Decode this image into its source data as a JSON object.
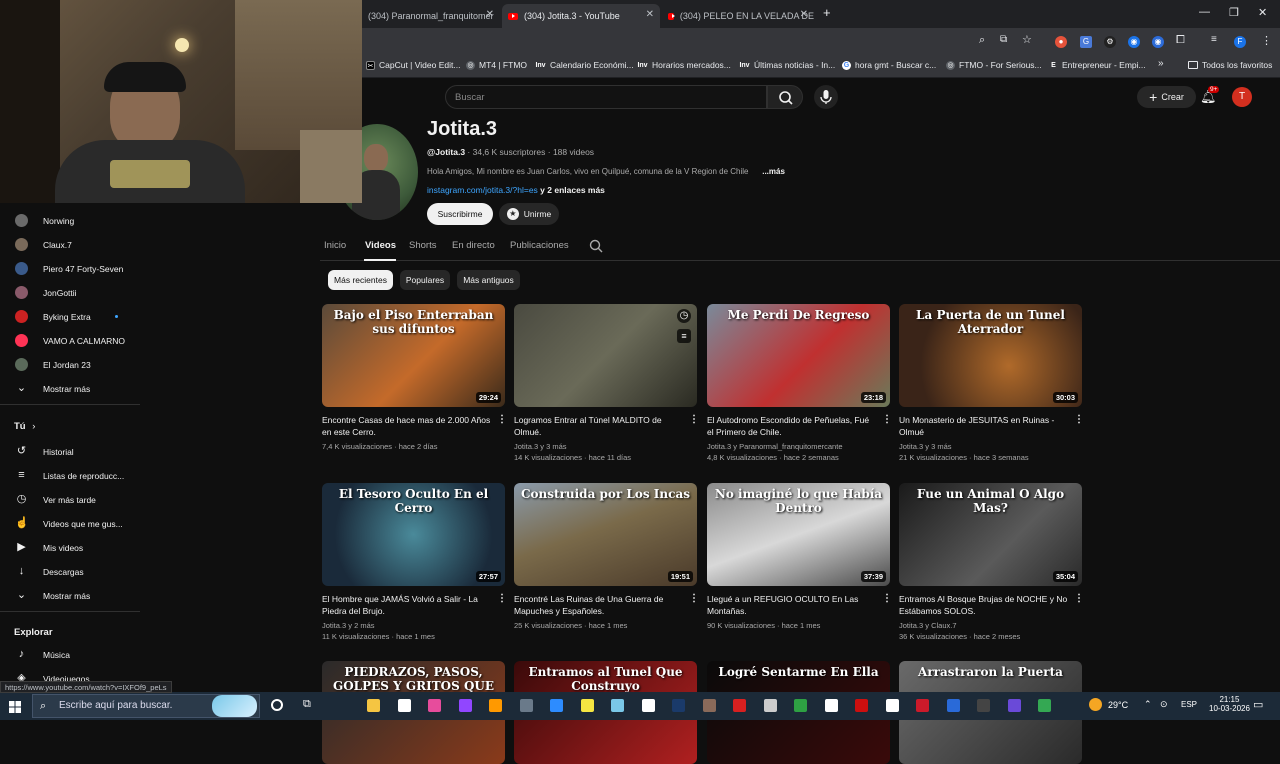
{
  "browser": {
    "tabs": [
      {
        "label": "(304) Paranormal_franquitomer",
        "active": false
      },
      {
        "label": "(304) Jotita.3 - YouTube",
        "active": true
      },
      {
        "label": "(304) PELEO EN LA VELADA DE",
        "active": false
      }
    ],
    "new_tab": "+",
    "bookmarks": [
      {
        "label": "CapCut | Video Edit...",
        "color": "#000000",
        "glyph": "✂"
      },
      {
        "label": "MT4 | FTMO",
        "color": "#5f6368",
        "glyph": "◎"
      },
      {
        "label": "Calendario Económi...",
        "color": "#35363a",
        "glyph": "Inv"
      },
      {
        "label": "Horarios mercados...",
        "color": "#35363a",
        "glyph": "Inv"
      },
      {
        "label": "Últimas noticias - In...",
        "color": "#35363a",
        "glyph": "Inv"
      },
      {
        "label": "hora gmt - Buscar c...",
        "color": "#4285f4",
        "glyph": "G"
      },
      {
        "label": "FTMO - For Serious...",
        "color": "#5f6368",
        "glyph": "◎"
      },
      {
        "label": "Entrepreneur - Empi...",
        "color": "#35363a",
        "glyph": "E"
      }
    ],
    "bookmarks_more": "»",
    "all_favorites": "Todos los favoritos",
    "status_url": "https://www.youtube.com/watch?v=IXFOf9_peLs"
  },
  "header": {
    "search_placeholder": "Buscar",
    "create_label": "Crear",
    "notification_badge": "9+",
    "account_initial": "T"
  },
  "sidebar": {
    "subscriptions": [
      {
        "label": "Norwing",
        "color": "#6a6a6a"
      },
      {
        "label": "Claux.7",
        "color": "#7a6a5a"
      },
      {
        "label": "Piero 47 Forty-Seven",
        "color": "#3a5a8a"
      },
      {
        "label": "JonGottii",
        "color": "#8a5a6a"
      },
      {
        "label": "Byking Extra",
        "color": "#cc2222"
      },
      {
        "label": "VAMO A CALMARNO",
        "color": "#ff3355"
      },
      {
        "label": "El Jordan 23",
        "color": "#5a6a5a"
      }
    ],
    "show_more_1": "Mostrar más",
    "you_title": "Tú",
    "you_items": [
      {
        "label": "Historial",
        "icon": "history-icon",
        "glyph": "↺"
      },
      {
        "label": "Listas de reproducc...",
        "icon": "playlist-icon",
        "glyph": "≡"
      },
      {
        "label": "Ver más tarde",
        "icon": "clock-icon",
        "glyph": "◷"
      },
      {
        "label": "Videos que me gus...",
        "icon": "like-icon",
        "glyph": "👍"
      },
      {
        "label": "Mis videos",
        "icon": "my-videos-icon",
        "glyph": "▶"
      },
      {
        "label": "Descargas",
        "icon": "download-icon",
        "glyph": "↓"
      }
    ],
    "show_more_2": "Mostrar más",
    "explore_title": "Explorar",
    "explore_items": [
      {
        "label": "Música",
        "icon": "music-icon",
        "glyph": "♪"
      },
      {
        "label": "Videojuegos",
        "icon": "gaming-icon",
        "glyph": "🎮"
      }
    ]
  },
  "channel": {
    "name": "Jotita.3",
    "handle": "@Jotita.3",
    "subscribers": "34,6 K suscriptores",
    "video_count": "188 videos",
    "description": "Hola Amigos, Mi nombre es Juan Carlos, vivo en Quilpué, comuna de la V Region de Chile",
    "more": "...más",
    "link": "instagram.com/jotita.3/?hl=es",
    "link_more": "y 2 enlaces más",
    "subscribe": "Suscribirme",
    "join": "Unirme",
    "tabs": [
      "Inicio",
      "Videos",
      "Shorts",
      "En directo",
      "Publicaciones"
    ],
    "active_tab": "Videos",
    "chips": [
      "Más recientes",
      "Populares",
      "Más antiguos"
    ]
  },
  "videos": [
    {
      "title": "Encontre Casas de hace mas de 2.000 Años en este Cerro.",
      "line2": "7,4 K visualizaciones · hace 2 días",
      "line3": "",
      "duration": "29:24",
      "overlay": "Bajo el Piso Enterraban sus difuntos",
      "bg": "linear-gradient(135deg,#5a4a3a,#c46a2a 55%,#3a2a1a)"
    },
    {
      "title": "Logramos Entrar al Túnel MALDITO de Olmué.",
      "line2": "Jotita.3 y 3 más",
      "line3": "14 K visualizaciones · hace 11 días",
      "duration": "",
      "overlay": "",
      "bg": "linear-gradient(135deg,#4a4a40,#6a6a58 50%,#2a2a22)"
    },
    {
      "title": "El Autodromo Escondido de Peñuelas, Fué el Primero de Chile.",
      "line2": "Jotita.3 y Paranormal_franquitomercante",
      "line3": "4,8 K visualizaciones · hace 2 semanas",
      "duration": "23:18",
      "overlay": "Me Perdi De Regreso",
      "bg": "linear-gradient(135deg,#7a8a9a,#c03030 55%,#6a7a5a)"
    },
    {
      "title": "Un Monasterio de JESUITAS en Ruinas - Olmué",
      "line2": "Jotita.3 y 3 más",
      "line3": "21 K visualizaciones · hace 3 semanas",
      "duration": "30:03",
      "overlay": "La Puerta de un Tunel Aterrador",
      "bg": "radial-gradient(circle at 60% 60%,#b06a2a,#3a2418 70%)"
    },
    {
      "title": "El Hombre que JAMÁS Volvió a Salir - La Piedra del Brujo.",
      "line2": "Jotita.3 y 2 más",
      "line3": "11 K visualizaciones · hace 1 mes",
      "duration": "27:57",
      "overlay": "El Tesoro Oculto En el Cerro",
      "bg": "radial-gradient(circle at 50% 50%,#4a8a9a,#1a2a3a 75%)"
    },
    {
      "title": "Encontré Las Ruinas de Una Guerra de Mapuches y Españoles.",
      "line2": "25 K visualizaciones · hace 1 mes",
      "line3": "",
      "duration": "19:51",
      "overlay": "Construida por Los Incas",
      "bg": "linear-gradient(160deg,#8a9aaa,#7a6a4a 45%,#4a3a2a)"
    },
    {
      "title": "Llegué a un REFUGIO OCULTO En Las Montañas.",
      "line2": "90 K visualizaciones · hace 1 mes",
      "line3": "",
      "duration": "37:39",
      "overlay": "No imaginé lo que Había Dentro",
      "bg": "linear-gradient(160deg,#8a8a8a,#d8d8d8 50%,#4a4a4a)"
    },
    {
      "title": "Entramos Al Bosque Brujas de NOCHE y No Estábamos SOLOS.",
      "line2": "Jotita.3 y Claux.7",
      "line3": "36 K visualizaciones · hace 2 meses",
      "duration": "35:04",
      "overlay": "Fue un Animal O Algo Mas?",
      "bg": "linear-gradient(135deg,#1a1a1a,#5a5a5a 60%,#2a2a2a)"
    },
    {
      "title": "",
      "line2": "",
      "line3": "",
      "duration": "",
      "overlay": "PIEDRAZOS, PASOS, GOLPES Y GRITOS QUE ME ATERRARON",
      "bg": "linear-gradient(135deg,#2a2a2a,#8a3a1a)"
    },
    {
      "title": "",
      "line2": "",
      "line3": "",
      "duration": "",
      "overlay": "Entramos al Tunel Que Construyo",
      "bg": "linear-gradient(135deg,#3a0a0a,#b02020)"
    },
    {
      "title": "",
      "line2": "",
      "line3": "",
      "duration": "",
      "overlay": "Logré Sentarme En Ella",
      "bg": "linear-gradient(135deg,#0a0a0a,#3a0a0a)"
    },
    {
      "title": "",
      "line2": "",
      "line3": "",
      "duration": "",
      "overlay": "Arrastraron la Puerta",
      "bg": "linear-gradient(135deg,#6a6a6a,#2a2a2a)"
    }
  ],
  "taskbar": {
    "search_placeholder": "Escribe aquí para buscar.",
    "weather": "29°C",
    "language": "ESP",
    "time": "21:15",
    "date": "10-03-2026"
  }
}
